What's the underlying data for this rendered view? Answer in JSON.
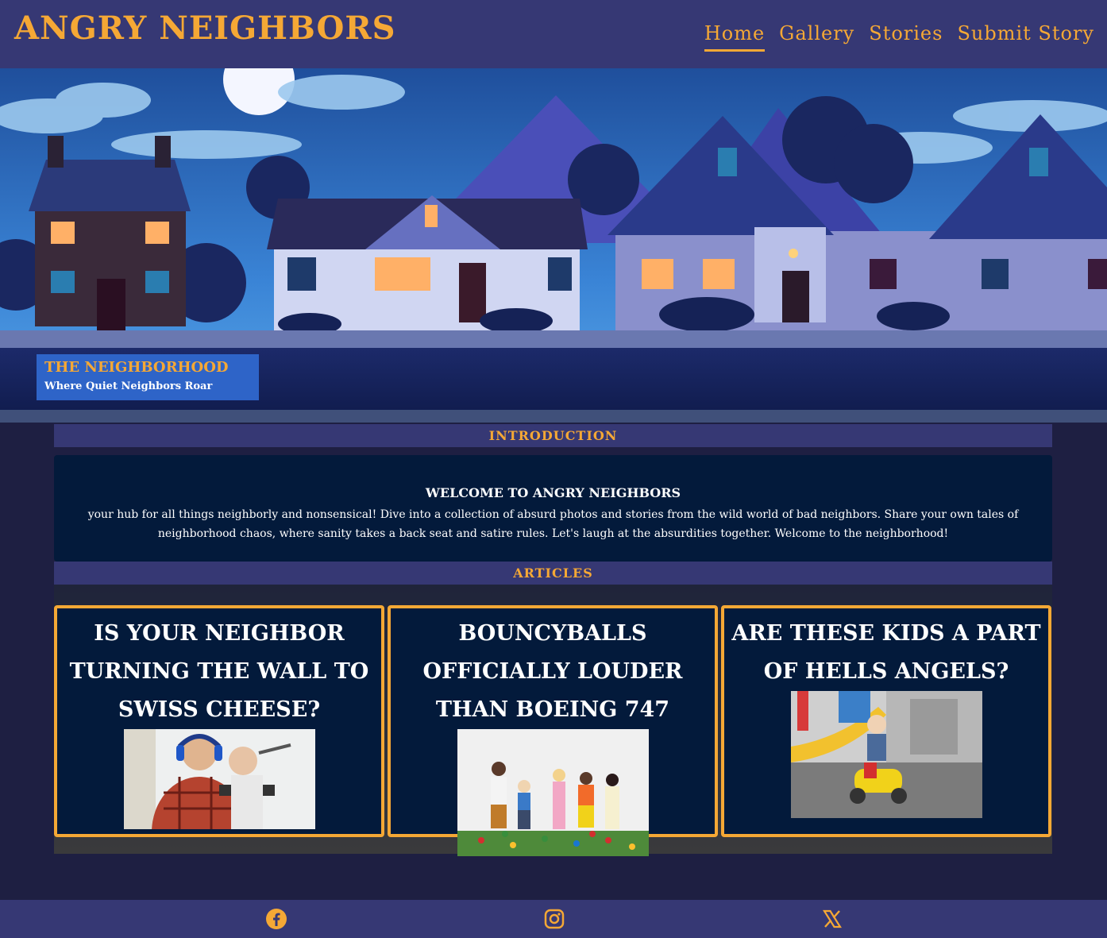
{
  "header": {
    "logo": "ANGRY NEIGHBORS",
    "nav": [
      {
        "label": "Home",
        "active": true
      },
      {
        "label": "Gallery",
        "active": false
      },
      {
        "label": "Stories",
        "active": false
      },
      {
        "label": "Submit Story",
        "active": false
      }
    ]
  },
  "hero": {
    "caption_title": "THE NEIGHBORHOOD",
    "caption_subtitle": "Where Quiet Neighbors Roar"
  },
  "intro": {
    "section_label": "INTRODUCTION",
    "heading": "WELCOME TO ANGRY NEIGHBORS",
    "body": "your hub for all things neighborly and nonsensical! Dive into a collection of absurd photos and stories from the wild world of bad neighbors. Share your own tales of neighborhood chaos, where sanity takes a back seat and satire rules. Let's laugh at the absurdities together. Welcome to the neighborhood!"
  },
  "articles": {
    "section_label": "ARTICLES",
    "items": [
      {
        "title": "IS YOUR NEIGHBOR TURNING THE WALL TO SWISS CHEESE?"
      },
      {
        "title": "BOUNCYBALLS OFFICIALLY LOUDER THAN BOEING 747"
      },
      {
        "title": "ARE THESE KIDS A PART OF HELLS ANGELS?"
      }
    ]
  },
  "footer": {
    "icons": [
      "facebook-icon",
      "instagram-icon",
      "x-icon"
    ]
  },
  "colors": {
    "accent": "#f5a835",
    "header_bg": "#363874",
    "page_bg": "#1e1f42",
    "panel_bg": "#031a3b"
  }
}
